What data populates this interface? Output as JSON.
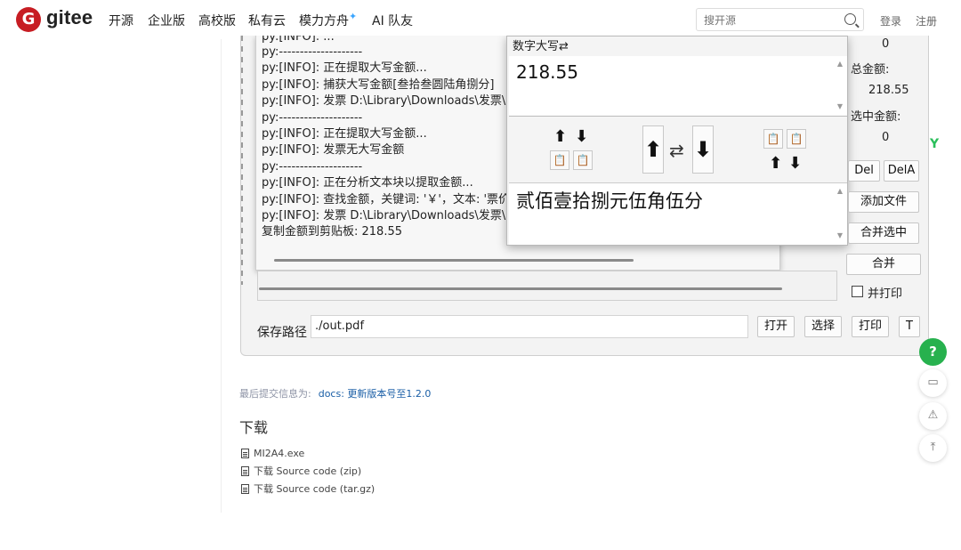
{
  "nav": {
    "logo_glyph": "G",
    "brand": "gitee",
    "items": [
      "开源",
      "企业版",
      "高校版",
      "私有云",
      "模力方舟",
      "AI 队友"
    ],
    "spark": "✦",
    "search_placeholder": "搜开源",
    "login": "登录",
    "register": "注册"
  },
  "screenshot": {
    "log_lines": [
      "py:[INFO]: ...",
      "py:--------------------",
      "py:[INFO]:  正在提取大写金额...",
      "py:[INFO]:  捕获大写金额[叁拾叁圆陆角捌分]",
      "py:[INFO]:  发票 D:\\Library\\Downloads\\发票\\qq",
      "py:--------------------",
      "py:[INFO]:  正在提取大写金额...",
      "py:[INFO]:  发票无大写金额",
      "py:--------------------",
      "py:[INFO]:  正在分析文本块以提取金额...",
      "py:[INFO]:  查找金额，关键词: '￥'，文本: '票价",
      "py:[INFO]:  发票 D:\\Library\\Downloads\\发票\\qq",
      "复制金额到剪贴板: 218.55"
    ],
    "converter": {
      "title": "数字大写⇄",
      "number": "218.55",
      "uppercase": "贰佰壹拾捌元伍角伍分",
      "up_arrow": "⬆",
      "down_arrow": "⬇",
      "swap": "⇄",
      "clip": "📋",
      "scroll_up": "▲",
      "scroll_down": "▼"
    },
    "right": {
      "count": "0",
      "total_label": "总金额:",
      "total_value": "218.55",
      "selected_label": "选中金额:",
      "selected_value": "0",
      "buttons": {
        "del": "Del",
        "dela": "DelA",
        "add_file": "添加文件",
        "merge_selected": "合并选中",
        "merge": "合并",
        "merge_print": "并打印"
      }
    },
    "save": {
      "label": "保存路径",
      "path": "./out.pdf",
      "open": "打开",
      "choose": "选择",
      "print": "打印",
      "t": "T"
    }
  },
  "commit": {
    "label": "最后提交信息为:",
    "message": "docs: 更新版本号至1.2.0"
  },
  "downloads": {
    "title": "下载",
    "items": [
      "MI2A4.exe",
      "下载 Source code (zip)",
      "下载 Source code (tar.gz)"
    ]
  },
  "float": {
    "help": "?",
    "comment": "▭",
    "warn": "⚠",
    "top": "⤒",
    "side_logo": "Y"
  }
}
